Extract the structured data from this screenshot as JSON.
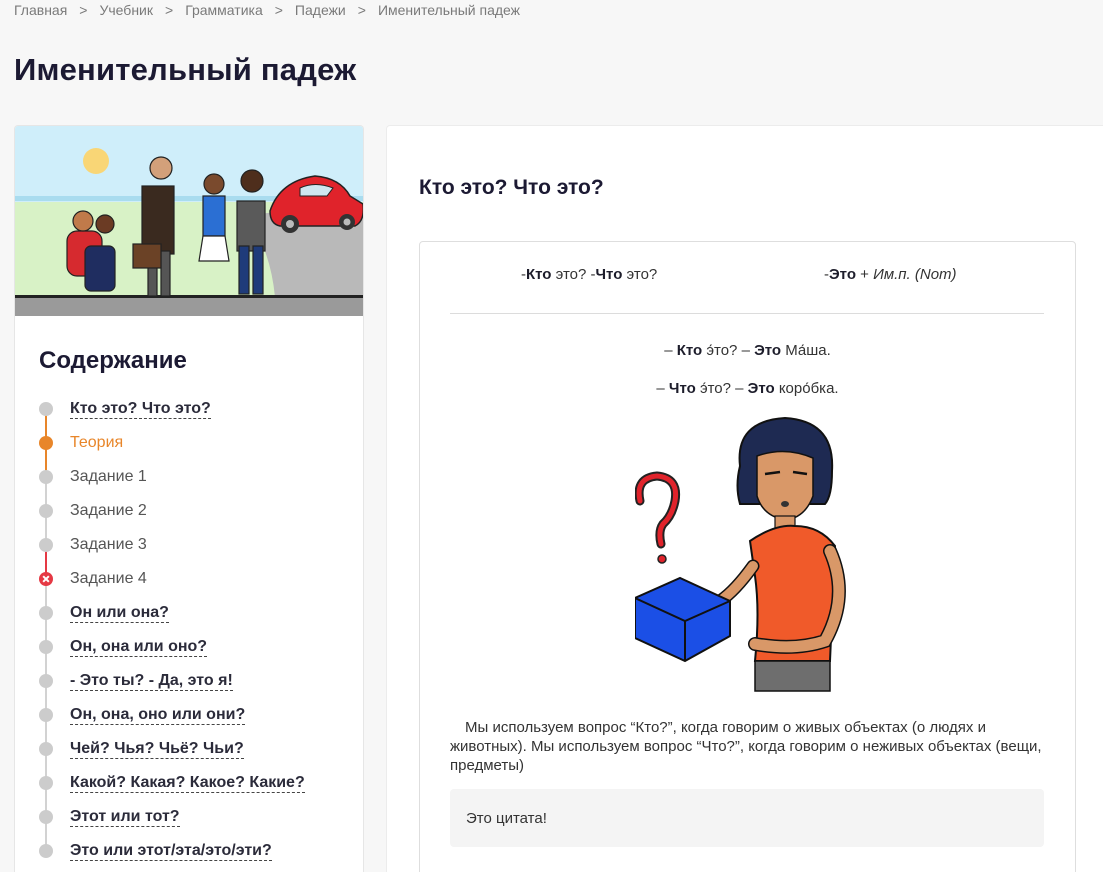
{
  "breadcrumb": [
    {
      "label": "Главная"
    },
    {
      "label": "Учебник"
    },
    {
      "label": "Грамматика"
    },
    {
      "label": "Падежи"
    },
    {
      "label": "Именительный падеж"
    }
  ],
  "breadcrumb_separator": ">",
  "page_title": "Именительный падеж",
  "toc": {
    "title": "Содержание",
    "items": [
      {
        "label": "Кто это? Что это?",
        "style": "link",
        "state": "normal"
      },
      {
        "label": "Теория",
        "style": "plain",
        "state": "active"
      },
      {
        "label": "Задание 1",
        "style": "plain",
        "state": "normal"
      },
      {
        "label": "Задание 2",
        "style": "plain",
        "state": "normal"
      },
      {
        "label": "Задание 3",
        "style": "plain",
        "state": "normal"
      },
      {
        "label": "Задание 4",
        "style": "plain",
        "state": "failed"
      },
      {
        "label": "Он или она?",
        "style": "link",
        "state": "normal"
      },
      {
        "label": "Он, она или оно?",
        "style": "link",
        "state": "normal"
      },
      {
        "label": "- Это ты? - Да, это я!",
        "style": "link",
        "state": "normal"
      },
      {
        "label": "Он, она, оно или они?",
        "style": "link",
        "state": "normal"
      },
      {
        "label": "Чей? Чья? Чьё? Чьи?",
        "style": "link",
        "state": "normal"
      },
      {
        "label": "Какой? Какая? Какое? Какие?",
        "style": "link",
        "state": "normal"
      },
      {
        "label": "Этот или тот?",
        "style": "link",
        "state": "normal"
      },
      {
        "label": "Это или этот/эта/это/эти?",
        "style": "link",
        "state": "normal"
      }
    ]
  },
  "main": {
    "section_title": "Кто это? Что это?",
    "formula_left": {
      "dash1": "-",
      "kto": "Кто",
      "eto1": " это? ",
      "dash2": "-",
      "chto": "Что",
      "eto2": " это?"
    },
    "formula_right": {
      "dash": "-",
      "eto": "Это",
      "plus": " + ",
      "case": "Им.п. (Nom)"
    },
    "example_1": {
      "prefix": "– ",
      "kto": "Кто",
      "mid": " э́то? – ",
      "eto": "Это",
      "answer": " Ма́ша."
    },
    "example_2": {
      "prefix": "– ",
      "chto": "Что",
      "mid": " э́то? – ",
      "eto": "Это",
      "answer": " коро́бка."
    },
    "paragraph": "Мы используем вопрос “Кто?”, когда говорим о живых объектах (о людях и животных). Мы используем вопрос “Что?”, когда говорим о неживых объектах (вещи, предметы)",
    "quote": "Это цитата!"
  },
  "colors": {
    "active": "#e8862a",
    "failed": "#e53944",
    "inactive": "#cccccc",
    "title": "#1c1a33"
  }
}
